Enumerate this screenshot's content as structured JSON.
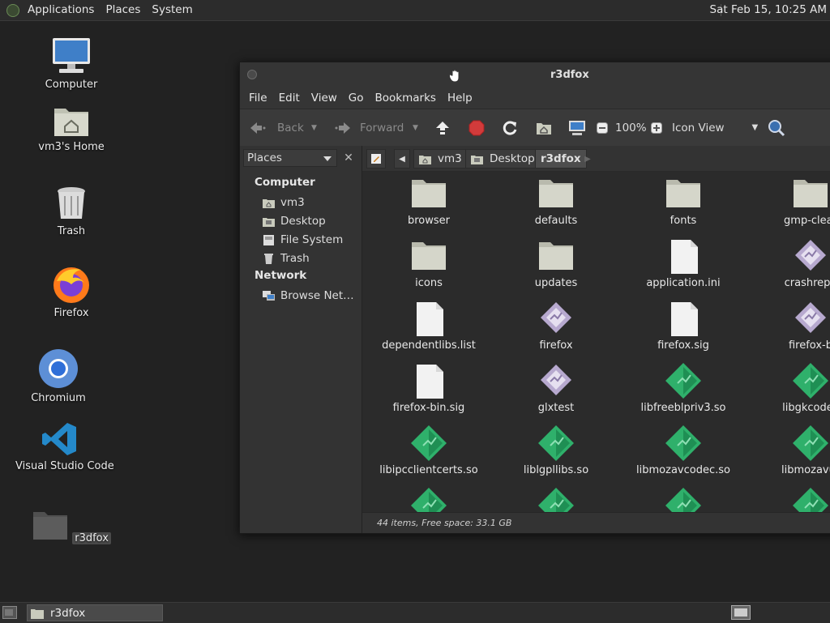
{
  "top_panel": {
    "menus": [
      "Applications",
      "Places",
      "System"
    ],
    "clock": "Sat Feb 15, 10:25 AM"
  },
  "desktop": {
    "icons": [
      {
        "label": "Computer",
        "icon": "computer-icon"
      },
      {
        "label": "vm3's Home",
        "icon": "home-folder-icon"
      },
      {
        "label": "Trash",
        "icon": "trash-icon"
      },
      {
        "label": "Firefox",
        "icon": "firefox-icon"
      },
      {
        "label": "Chromium",
        "icon": "chromium-icon"
      },
      {
        "label": "Visual Studio Code",
        "icon": "vscode-icon"
      },
      {
        "label": "r3dfox",
        "icon": "folder-icon"
      }
    ]
  },
  "window": {
    "title": "r3dfox",
    "menu": [
      "File",
      "Edit",
      "View",
      "Go",
      "Bookmarks",
      "Help"
    ],
    "toolbar": {
      "back": "Back",
      "forward": "Forward",
      "zoom": "100%",
      "view_mode": "Icon View"
    },
    "sidebar": {
      "selector": "Places",
      "sections": [
        {
          "heading": "Computer",
          "items": [
            "vm3",
            "Desktop",
            "File System",
            "Trash"
          ]
        },
        {
          "heading": "Network",
          "items": [
            "Browse Net…"
          ]
        }
      ]
    },
    "breadcrumbs": [
      "vm3",
      "Desktop",
      "r3dfox"
    ],
    "files": [
      {
        "name": "browser",
        "type": "folder"
      },
      {
        "name": "defaults",
        "type": "folder"
      },
      {
        "name": "fonts",
        "type": "folder"
      },
      {
        "name": "gmp-clear",
        "type": "folder"
      },
      {
        "name": "icons",
        "type": "folder"
      },
      {
        "name": "updates",
        "type": "folder"
      },
      {
        "name": "application.ini",
        "type": "text"
      },
      {
        "name": "crashrepo",
        "type": "exec"
      },
      {
        "name": "dependentlibs.list",
        "type": "text"
      },
      {
        "name": "firefox",
        "type": "exec"
      },
      {
        "name": "firefox.sig",
        "type": "text"
      },
      {
        "name": "firefox-b",
        "type": "exec"
      },
      {
        "name": "firefox-bin.sig",
        "type": "text"
      },
      {
        "name": "glxtest",
        "type": "exec"
      },
      {
        "name": "libfreeblpriv3.so",
        "type": "lib"
      },
      {
        "name": "libgkcodec",
        "type": "lib"
      },
      {
        "name": "libipcclientcerts.so",
        "type": "lib"
      },
      {
        "name": "liblgpllibs.so",
        "type": "lib"
      },
      {
        "name": "libmozavcodec.so",
        "type": "lib"
      },
      {
        "name": "libmozavut",
        "type": "lib"
      },
      {
        "name": "",
        "type": "lib"
      },
      {
        "name": "",
        "type": "lib"
      },
      {
        "name": "",
        "type": "lib"
      },
      {
        "name": "",
        "type": "lib"
      }
    ],
    "status": "44 items, Free space: 33.1 GB"
  },
  "bottom_panel": {
    "task": "r3dfox"
  },
  "colors": {
    "panel": "#2c2c2c",
    "desktop": "#222222",
    "folder": "#cfd0c4",
    "lib": "#2fb06b",
    "exec": "#b7a9cf"
  }
}
